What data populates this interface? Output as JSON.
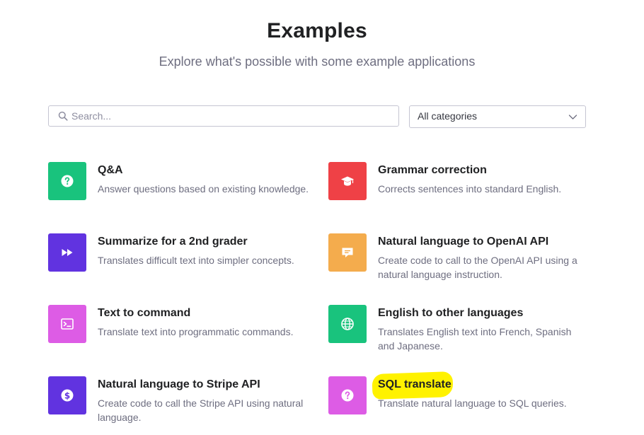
{
  "header": {
    "title": "Examples",
    "subtitle": "Explore what's possible with some example applications"
  },
  "search": {
    "placeholder": "Search...",
    "value": ""
  },
  "category_filter": {
    "selected": "All categories"
  },
  "colors": {
    "green": "#19c37d",
    "red": "#ef4146",
    "purple": "#5436da",
    "orange": "#f4ac36",
    "pink": "#dd5ce5",
    "highlight": "#fff200"
  },
  "examples": [
    {
      "title": "Q&A",
      "description": "Answer questions based on existing knowledge.",
      "icon": "question-icon",
      "color": "#19c37d"
    },
    {
      "title": "Grammar correction",
      "description": "Corrects sentences into standard English.",
      "icon": "graduation-cap-icon",
      "color": "#ef4146"
    },
    {
      "title": "Summarize for a 2nd grader",
      "description": "Translates difficult text into simpler concepts.",
      "icon": "fast-forward-icon",
      "color": "#6133e0"
    },
    {
      "title": "Natural language to OpenAI API",
      "description": "Create code to call to the OpenAI API using a natural language instruction.",
      "icon": "chat-bubble-icon",
      "color": "#f4ac4d"
    },
    {
      "title": "Text to command",
      "description": "Translate text into programmatic commands.",
      "icon": "terminal-icon",
      "color": "#dd5ce5"
    },
    {
      "title": "English to other languages",
      "description": "Translates English text into French, Spanish and Japanese.",
      "icon": "globe-icon",
      "color": "#19c37d"
    },
    {
      "title": "Natural language to Stripe API",
      "description": "Create code to call the Stripe API using natural language.",
      "icon": "dollar-icon",
      "color": "#6133e0"
    },
    {
      "title": "SQL translate",
      "description": "Translate natural language to SQL queries.",
      "icon": "question-icon",
      "color": "#dd5ce5"
    }
  ]
}
